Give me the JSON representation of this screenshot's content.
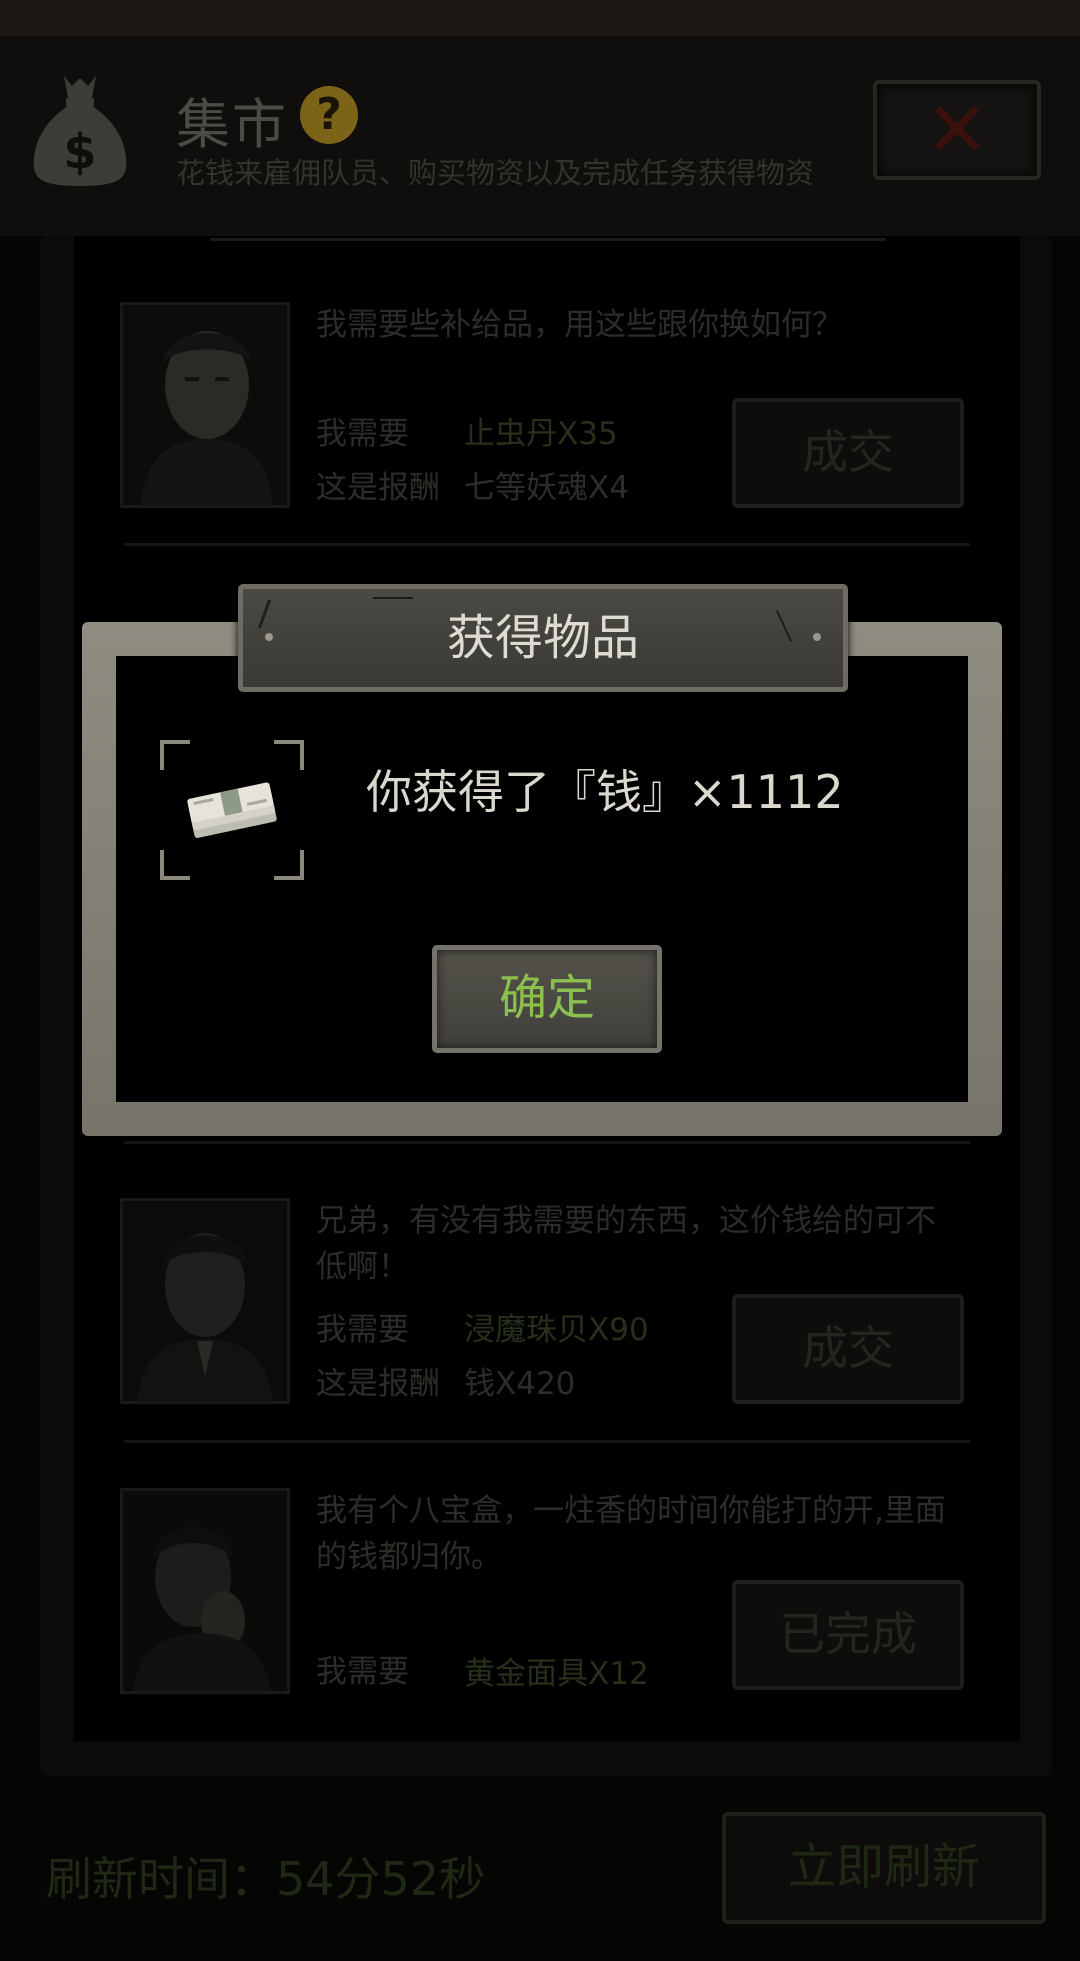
{
  "header": {
    "title": "集市",
    "help_symbol": "?",
    "subtitle": "花钱来雇佣队员、购买物资以及完成任务获得物资",
    "close_symbol": "✕",
    "bag_symbol": "$"
  },
  "cards": [
    {
      "message": "我需要些补给品，用这些跟你换如何？",
      "need_label": "我需要",
      "need_value": "止虫丹X35",
      "reward_label": "这是报酬",
      "reward_value": "七等妖魂X4",
      "button": "成交"
    },
    {
      "message": "兄弟，有没有我需要的东西，这价钱给的可不低啊！",
      "need_label": "我需要",
      "need_value": "浸魔珠贝X90",
      "reward_label": "这是报酬",
      "reward_value": "钱X420",
      "button": "成交"
    },
    {
      "message": "我有个八宝盒，一炷香的时间你能打的开,里面的钱都归你。",
      "need_label": "我需要",
      "need_value": "黄金面具X12",
      "button": "已完成"
    }
  ],
  "footer": {
    "refresh_time": "刷新时间：54分52秒",
    "refresh_button": "立即刷新"
  },
  "modal": {
    "title": "获得物品",
    "message": "你获得了『钱』×1112",
    "item_icon": "money-stack",
    "confirm": "确定"
  },
  "colors": {
    "accent_green": "#8bbf4f",
    "help_yellow": "#7b6318",
    "close_red": "#3a100d"
  }
}
